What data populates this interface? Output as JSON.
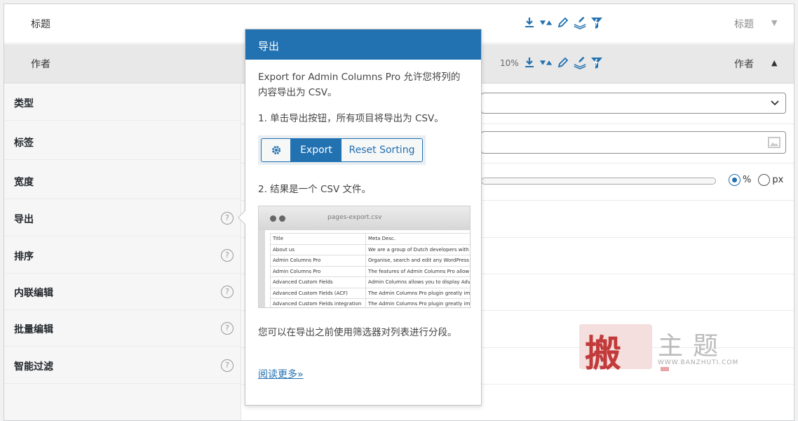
{
  "columns": [
    {
      "label": "标题",
      "type": "标题",
      "width_text": "",
      "expanded": false
    },
    {
      "label": "作者",
      "type": "作者",
      "width_text": "10%",
      "expanded": true
    }
  ],
  "tool_icons": [
    "download-icon",
    "sort-icon",
    "pencil-icon",
    "bulk-edit-icon",
    "smart-filter-icon"
  ],
  "settings": {
    "rows": [
      {
        "label": "类型",
        "help": false
      },
      {
        "label": "标签",
        "help": false
      },
      {
        "label": "宽度",
        "help": false
      },
      {
        "label": "导出",
        "help": true
      },
      {
        "label": "排序",
        "help": true
      },
      {
        "label": "内联编辑",
        "help": true
      },
      {
        "label": "批量编辑",
        "help": true
      },
      {
        "label": "智能过滤",
        "help": true
      }
    ],
    "help_glyph": "?",
    "width_units": {
      "percent": "%",
      "px": "px",
      "selected": "percent"
    }
  },
  "popup": {
    "title": "导出",
    "intro": "Export for Admin Columns Pro 允许您将列的内容导出为 CSV。",
    "step1": "1. 单击导出按钮，所有项目将导出为 CSV。",
    "demo_buttons": {
      "export": "Export",
      "reset": "Reset Sorting"
    },
    "step2": "2. 结果是一个 CSV 文件。",
    "csv_preview": {
      "filename": "pages-export.csv",
      "header": [
        "Title",
        "Meta Desc."
      ],
      "rows": [
        [
          "About us",
          "We are a group of Dutch developers with"
        ],
        [
          "Admin Columns Pro",
          "Organise, search and edit any WordPress"
        ],
        [
          "Admin Columns Pro",
          "The features of Admin Columns Pro allow"
        ],
        [
          "Advanced Custom Fields",
          "Admin Columns allows you to display Adv"
        ],
        [
          "Advanced Custom Fields (ACF)",
          "The Admin Columns Pro plugin greatly im"
        ],
        [
          "Advanced Custom Fields integration",
          "The Admin Columns Pro plugin greatly im"
        ]
      ]
    },
    "note": "您可以在导出之前使用筛选器对列表进行分段。",
    "read_more": "阅读更多»"
  },
  "watermark": {
    "seal_char": "搬",
    "words": "主题",
    "url": "WWW.BANZHUTI.COM"
  },
  "colors": {
    "accent": "#2271b1",
    "watermark_red": "#c23a3a"
  }
}
